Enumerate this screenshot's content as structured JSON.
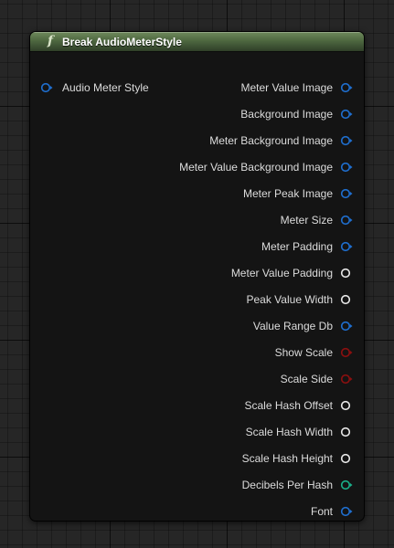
{
  "node": {
    "icon": "function-icon",
    "title": "Break AudioMeterStyle",
    "colors": {
      "header_top": "#6f8a5c",
      "header_bottom": "#2f3f28",
      "body": "#141414"
    }
  },
  "input_pins": [
    {
      "label": "Audio Meter Style",
      "type": "struct",
      "color": "#1f6fd0"
    }
  ],
  "output_pins": [
    {
      "label": "Meter Value Image",
      "type": "struct",
      "color": "#1f6fd0"
    },
    {
      "label": "Background Image",
      "type": "struct",
      "color": "#1f6fd0"
    },
    {
      "label": "Meter Background Image",
      "type": "struct",
      "color": "#1f6fd0"
    },
    {
      "label": "Meter Value Background Image",
      "type": "struct",
      "color": "#1f6fd0"
    },
    {
      "label": "Meter Peak Image",
      "type": "struct",
      "color": "#1f6fd0"
    },
    {
      "label": "Meter Size",
      "type": "struct",
      "color": "#1f6fd0"
    },
    {
      "label": "Meter Padding",
      "type": "struct",
      "color": "#1f6fd0"
    },
    {
      "label": "Meter Value Padding",
      "type": "float",
      "color": "#e8e8e8"
    },
    {
      "label": "Peak Value Width",
      "type": "float",
      "color": "#e8e8e8"
    },
    {
      "label": "Value Range Db",
      "type": "struct",
      "color": "#1f6fd0"
    },
    {
      "label": "Show Scale",
      "type": "bool",
      "color": "#8c0f0f"
    },
    {
      "label": "Scale Side",
      "type": "bool",
      "color": "#8c0f0f"
    },
    {
      "label": "Scale Hash Offset",
      "type": "float",
      "color": "#e8e8e8"
    },
    {
      "label": "Scale Hash Width",
      "type": "float",
      "color": "#e8e8e8"
    },
    {
      "label": "Scale Hash Height",
      "type": "float",
      "color": "#e8e8e8"
    },
    {
      "label": "Decibels Per Hash",
      "type": "struct",
      "color": "#1ab08a"
    },
    {
      "label": "Font",
      "type": "struct",
      "color": "#1f6fd0"
    }
  ]
}
